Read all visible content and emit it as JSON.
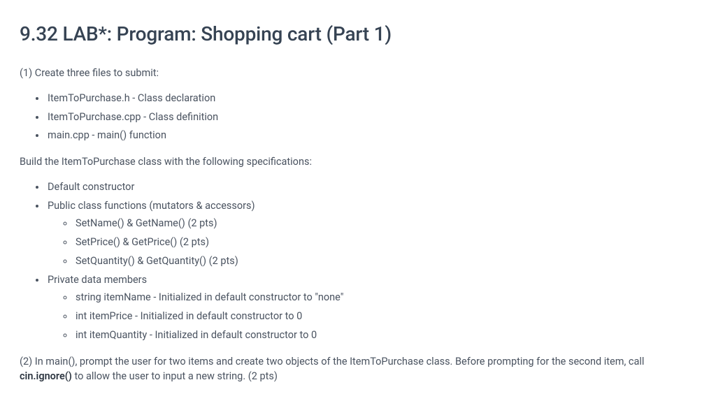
{
  "title": "9.32 LAB*: Program: Shopping cart (Part 1)",
  "section1": {
    "intro": "(1) Create three files to submit:",
    "files": [
      "ItemToPurchase.h - Class declaration",
      "ItemToPurchase.cpp - Class definition",
      "main.cpp - main() function"
    ],
    "build_intro": "Build the ItemToPurchase class with the following specifications:",
    "specs": [
      {
        "label": "Default constructor",
        "children": []
      },
      {
        "label": "Public class functions (mutators & accessors)",
        "children": [
          "SetName() & GetName() (2 pts)",
          "SetPrice() & GetPrice() (2 pts)",
          "SetQuantity() & GetQuantity() (2 pts)"
        ]
      },
      {
        "label": "Private data members",
        "children": [
          "string itemName - Initialized in default constructor to \"none\"",
          "int itemPrice - Initialized in default constructor to 0",
          "int itemQuantity - Initialized in default constructor to 0"
        ]
      }
    ]
  },
  "section2": {
    "text_before": "(2) In main(), prompt the user for two items and create two objects of the ItemToPurchase class. Before prompting for the second item, call ",
    "bold": "cin.ignore()",
    "text_after": " to allow the user to input a new string. (2 pts)"
  }
}
